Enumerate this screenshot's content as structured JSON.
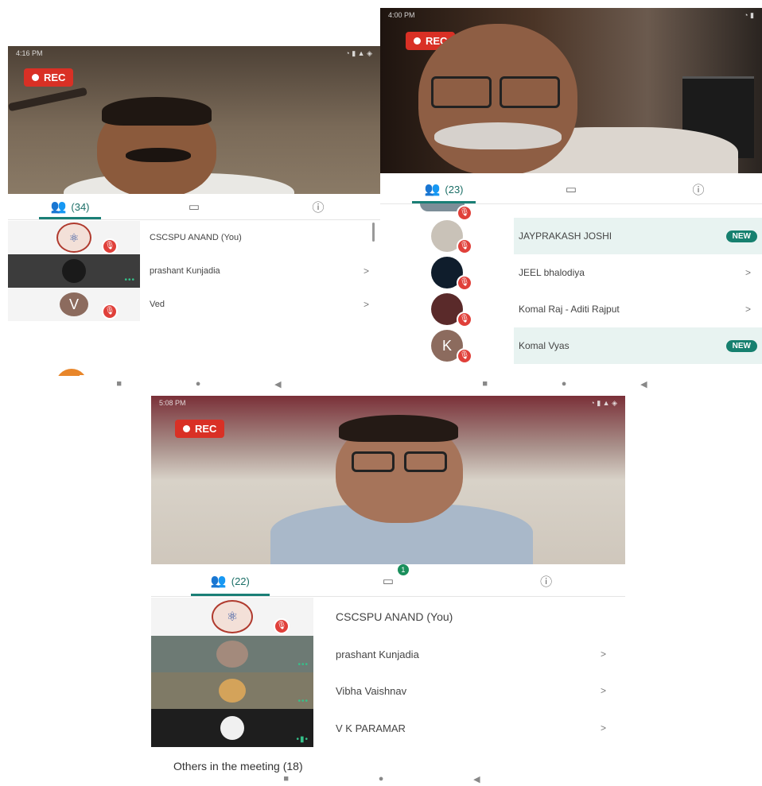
{
  "shot1": {
    "status_time": "4:16 PM",
    "status_right": "◔ ▮ ▲ ◈",
    "rec": "REC",
    "participants_count": "(34)",
    "participants": [
      {
        "name": "CSCSPU ANAND (You)",
        "chevron": ""
      },
      {
        "name": "prashant Kunjadia",
        "chevron": ">"
      },
      {
        "name": "Ved",
        "chevron": ">",
        "initial": "V"
      }
    ]
  },
  "shot2": {
    "status_time": "4:00 PM",
    "status_right": "◔ ▮",
    "rec": "REC",
    "participants_count": "(23)",
    "participants": [
      {
        "name": "JAYPRAKASH JOSHI",
        "tag": "NEW"
      },
      {
        "name": "JEEL bhalodiya",
        "chevron": ">"
      },
      {
        "name": "Komal Raj - Aditi Rajput",
        "chevron": ">"
      },
      {
        "name": "Komal Vyas",
        "tag": "NEW",
        "initial": "K"
      }
    ]
  },
  "shot3": {
    "status_time": "5:08 PM",
    "status_right": "◔ ▮ ▲ ◈",
    "rec": "REC",
    "participants_count": "(22)",
    "chat_badge": "1",
    "participants": [
      {
        "name": "CSCSPU ANAND (You)",
        "chevron": ""
      },
      {
        "name": "prashant Kunjadia",
        "chevron": ">"
      },
      {
        "name": "Vibha Vaishnav",
        "chevron": ">"
      },
      {
        "name": "V K PARAMAR",
        "chevron": ">"
      }
    ],
    "others_label": "Others in the meeting (18)"
  },
  "icons": {
    "people": "people-icon",
    "chat": "chat-icon",
    "info": "info-icon",
    "mic_off": "mic-off-icon",
    "nav_recent": "recents-icon",
    "nav_home": "home-icon",
    "nav_back": "back-icon"
  },
  "colors": {
    "accent": "#1a7f76",
    "rec": "#d93025",
    "mute": "#e0403a",
    "new_tag": "#16806f"
  }
}
